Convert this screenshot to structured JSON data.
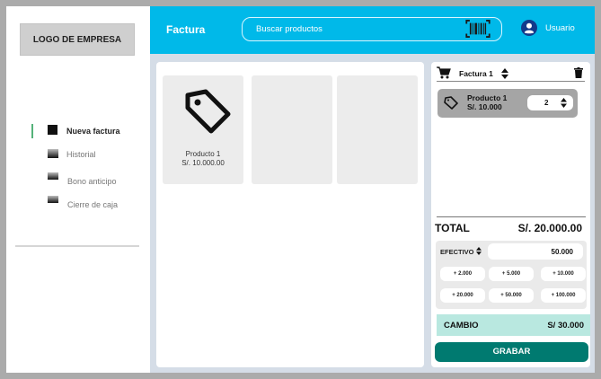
{
  "sidebar": {
    "logo": "LOGO DE EMPRESA",
    "items": [
      {
        "label": "Nueva factura",
        "active": true
      },
      {
        "label": "Historial",
        "active": false
      },
      {
        "label": "Bono anticipo",
        "active": false
      },
      {
        "label": "Cierre de caja",
        "active": false
      }
    ]
  },
  "header": {
    "title": "Factura",
    "search_placeholder": "Buscar productos",
    "user": "Usuario"
  },
  "products": [
    {
      "name": "Producto 1",
      "price": "S/. 10.000.00",
      "icon": "tag-icon"
    },
    {
      "name": "",
      "price": ""
    },
    {
      "name": "",
      "price": ""
    }
  ],
  "invoice": {
    "title": "Factura 1",
    "items": [
      {
        "name": "Producto 1",
        "price": "S/. 10.000",
        "qty": "2"
      }
    ],
    "total_label": "TOTAL",
    "total_value": "S/. 20.000.00",
    "payment_method": "EFECTIVO",
    "paid_amount": "50.000",
    "quick_amounts": [
      "+ 2.000",
      "+ 5.000",
      "+ 10.000",
      "+ 20.000",
      "+ 50.000",
      "+ 100.000"
    ],
    "change_label": "CAMBIO",
    "change_value": "S/ 30.000",
    "save_label": "GRABAR"
  },
  "colors": {
    "header": "#00b9e9",
    "active_indicator": "#55b27a",
    "change_bg": "#b9e8e0",
    "save_button": "#007a70"
  }
}
